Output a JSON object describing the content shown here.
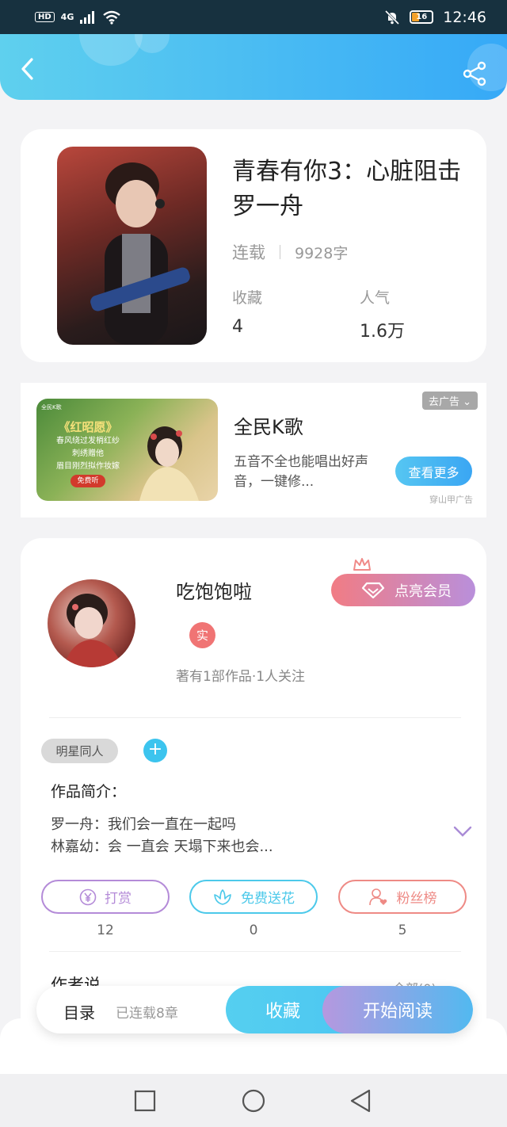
{
  "status_bar": {
    "time": "12:46",
    "network": "4G",
    "hd_label": "HD",
    "battery_level": "16"
  },
  "book": {
    "title": "青春有你3：心脏阻击罗一舟",
    "status": "连载",
    "word_count": "9928字",
    "favorites_label": "收藏",
    "favorites_value": "4",
    "popularity_label": "人气",
    "popularity_value": "1.6万"
  },
  "ad": {
    "title": "全民K歌",
    "description": "五音不全也能唱出好声音，一键修...",
    "see_more_label": "查看更多",
    "remove_ad_label": "去广告",
    "source_label": "穿山甲广告",
    "image_logo": "全民K歌",
    "image_headline": "《红昭愿》",
    "image_lines": [
      "春风绕过发梢红纱",
      "刺绣赠他",
      "眉目刚烈拟作妆嫁"
    ],
    "image_button": "免费听"
  },
  "author": {
    "name": "吃饱饱啦",
    "verified_label": "实",
    "stats": "著有1部作品·1人关注",
    "vip_label": "点亮会员"
  },
  "work": {
    "tag": "明星同人",
    "add_tag_label": "+",
    "intro_label": "作品简介：",
    "intro_line1": "罗一舟：我们会一直在一起吗",
    "intro_line2": "林嘉幼：会 一直会 天塌下来也会..."
  },
  "actions": [
    {
      "label": "打赏",
      "count": "12",
      "color": "#b48bd8"
    },
    {
      "label": "免费送花",
      "count": "0",
      "color": "#4cc9ea"
    },
    {
      "label": "粉丝榜",
      "count": "5",
      "color": "#ee8a85"
    }
  ],
  "author_say": {
    "label": "作者说",
    "see_all": "全部(0)"
  },
  "bottom_bar": {
    "toc_label": "目录",
    "serial_info": "已连载8章",
    "collect_label": "收藏",
    "read_label": "开始阅读"
  },
  "icons": {
    "back": "chevron-left-icon",
    "share": "share-icon",
    "crown": "crown-icon",
    "diamond": "diamond-icon",
    "expand": "chevron-down-icon"
  },
  "colors": {
    "accent": "#3aa6f3",
    "vip_start": "#f17c84",
    "vip_end": "#b98fdb"
  }
}
